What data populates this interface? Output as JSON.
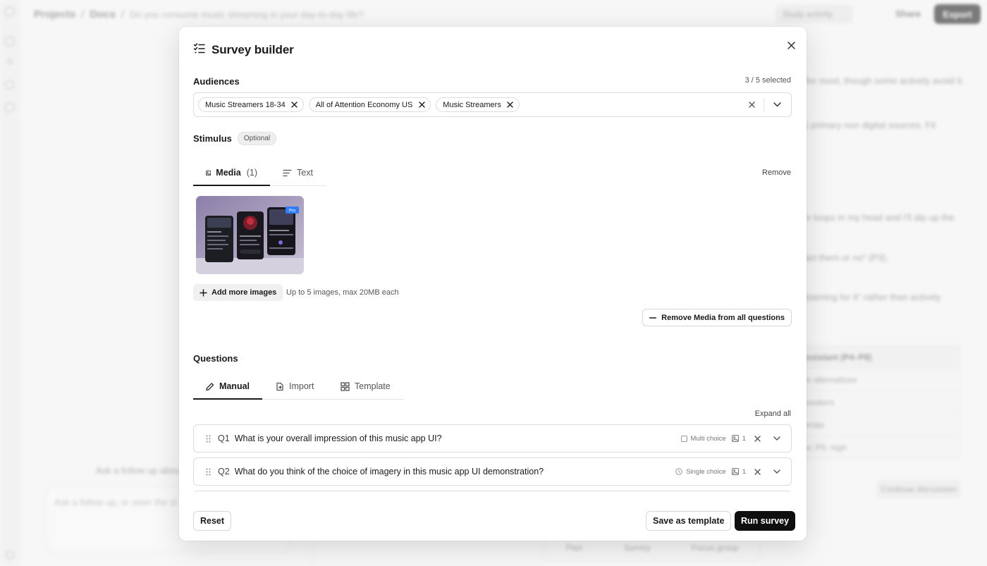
{
  "background": {
    "breadcrumb": [
      "Projects",
      "/",
      "Docs",
      "/",
      "Do you consume music streaming in your day-to-day life?"
    ],
    "study_activity": "Study activity",
    "share": "Share",
    "export": "Export",
    "right_text": [
      "for most, though some actively avoid it.",
      "s primary non digital sources. Fit",
      "e loops in my head and I'll dip up the",
      "iart them or no\" (P3).",
      "listening for it\" rather than actively"
    ],
    "table_rows": [
      "Assistant (P4–P8)",
      "ble alternatives",
      "t seekers",
      "derate",
      "ow; P5: high"
    ],
    "continue": "Continue discussion",
    "followup_label": "Ask a follow up about",
    "followup_placeholder": "Ask a follow up, or steer the st",
    "bottom_tabs": [
      "Plan",
      "Survey",
      "Focus group"
    ]
  },
  "modal": {
    "title": "Survey builder",
    "audiences": {
      "label": "Audiences",
      "count": "3 / 5 selected",
      "chips": [
        "Music Streamers 18-34",
        "All of Attention Economy US",
        "Music Streamers"
      ]
    },
    "stimulus": {
      "label": "Stimulus",
      "badge": "Optional",
      "tabs": [
        {
          "label": "Media",
          "count": "(1)"
        },
        {
          "label": "Text"
        }
      ],
      "remove": "Remove",
      "thumb_badge": "Pro",
      "add_images": "Add more images",
      "hint": "Up to 5 images, max 20MB each",
      "remove_media_all": "Remove Media from all questions"
    },
    "questions": {
      "label": "Questions",
      "tabs": [
        {
          "label": "Manual"
        },
        {
          "label": "Import"
        },
        {
          "label": "Template"
        }
      ],
      "expand_all": "Expand all",
      "items": [
        {
          "num": "Q1",
          "text": "What is your overall impression of this music app UI?",
          "type": "Multi choice",
          "media_count": "1"
        },
        {
          "num": "Q2",
          "text": "What do you think of the choice of imagery in this music app UI demonstration?",
          "type": "Single choice",
          "media_count": "1"
        }
      ]
    },
    "footer": {
      "reset": "Reset",
      "save_template": "Save as template",
      "run": "Run survey"
    }
  },
  "colors": {
    "primary": "#0f0f0f",
    "border": "#dcdcdc",
    "muted": "#555555"
  }
}
